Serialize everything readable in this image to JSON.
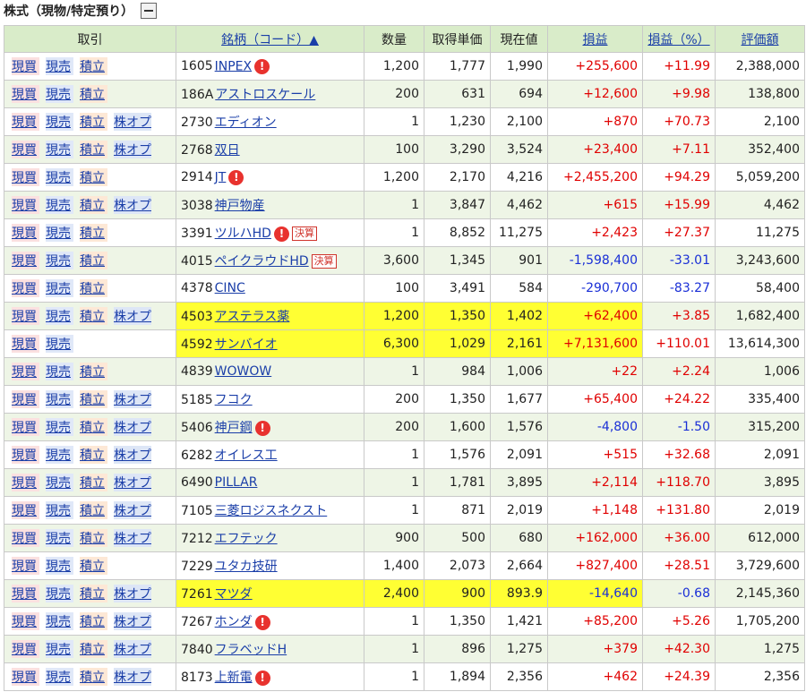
{
  "section": {
    "title": "株式（現物/特定預り）"
  },
  "headers": {
    "trade": "取引",
    "name": "銘柄（コード）▲",
    "qty": "数量",
    "cost": "取得単価",
    "price": "現在値",
    "pl": "損益",
    "plpct": "損益（%）",
    "value": "評価額"
  },
  "actions": {
    "buy": "現買",
    "sell": "現売",
    "accum": "積立",
    "opt": "株オプ"
  },
  "badges": {
    "alert": "!",
    "kessan": "決算"
  },
  "colors": {
    "header_bg": "#d9ecc9",
    "alt_row_bg": "#eef5e6",
    "highlight": "#ffff33",
    "profit": "#e00000",
    "loss": "#1a2fd6"
  },
  "rows": [
    {
      "code": "1605",
      "name": "INPEX",
      "qty": "1,200",
      "cost": "1,777",
      "price": "1,990",
      "pl": "+255,600",
      "plpct": "+11.99",
      "value": "2,388,000"
    },
    {
      "code": "186A",
      "name": "アストロスケール",
      "qty": "200",
      "cost": "631",
      "price": "694",
      "pl": "+12,600",
      "plpct": "+9.98",
      "value": "138,800"
    },
    {
      "code": "2730",
      "name": "エディオン",
      "qty": "1",
      "cost": "1,230",
      "price": "2,100",
      "pl": "+870",
      "plpct": "+70.73",
      "value": "2,100"
    },
    {
      "code": "2768",
      "name": "双日",
      "qty": "100",
      "cost": "3,290",
      "price": "3,524",
      "pl": "+23,400",
      "plpct": "+7.11",
      "value": "352,400"
    },
    {
      "code": "2914",
      "name": "JT",
      "qty": "1,200",
      "cost": "2,170",
      "price": "4,216",
      "pl": "+2,455,200",
      "plpct": "+94.29",
      "value": "5,059,200"
    },
    {
      "code": "3038",
      "name": "神戸物産",
      "qty": "1",
      "cost": "3,847",
      "price": "4,462",
      "pl": "+615",
      "plpct": "+15.99",
      "value": "4,462"
    },
    {
      "code": "3391",
      "name": "ツルハHD",
      "qty": "1",
      "cost": "8,852",
      "price": "11,275",
      "pl": "+2,423",
      "plpct": "+27.37",
      "value": "11,275"
    },
    {
      "code": "4015",
      "name": "ペイクラウドHD",
      "qty": "3,600",
      "cost": "1,345",
      "price": "901",
      "pl": "-1,598,400",
      "plpct": "-33.01",
      "value": "3,243,600"
    },
    {
      "code": "4378",
      "name": "CINC",
      "qty": "100",
      "cost": "3,491",
      "price": "584",
      "pl": "-290,700",
      "plpct": "-83.27",
      "value": "58,400"
    },
    {
      "code": "4503",
      "name": "アステラス薬",
      "qty": "1,200",
      "cost": "1,350",
      "price": "1,402",
      "pl": "+62,400",
      "plpct": "+3.85",
      "value": "1,682,400"
    },
    {
      "code": "4592",
      "name": "サンバイオ",
      "qty": "6,300",
      "cost": "1,029",
      "price": "2,161",
      "pl": "+7,131,600",
      "plpct": "+110.01",
      "value": "13,614,300"
    },
    {
      "code": "4839",
      "name": "WOWOW",
      "qty": "1",
      "cost": "984",
      "price": "1,006",
      "pl": "+22",
      "plpct": "+2.24",
      "value": "1,006"
    },
    {
      "code": "5185",
      "name": "フコク",
      "qty": "200",
      "cost": "1,350",
      "price": "1,677",
      "pl": "+65,400",
      "plpct": "+24.22",
      "value": "335,400"
    },
    {
      "code": "5406",
      "name": "神戸鋼",
      "qty": "200",
      "cost": "1,600",
      "price": "1,576",
      "pl": "-4,800",
      "plpct": "-1.50",
      "value": "315,200"
    },
    {
      "code": "6282",
      "name": "オイレス工",
      "qty": "1",
      "cost": "1,576",
      "price": "2,091",
      "pl": "+515",
      "plpct": "+32.68",
      "value": "2,091"
    },
    {
      "code": "6490",
      "name": "PILLAR",
      "qty": "1",
      "cost": "1,781",
      "price": "3,895",
      "pl": "+2,114",
      "plpct": "+118.70",
      "value": "3,895"
    },
    {
      "code": "7105",
      "name": "三菱ロジスネクスト",
      "qty": "1",
      "cost": "871",
      "price": "2,019",
      "pl": "+1,148",
      "plpct": "+131.80",
      "value": "2,019"
    },
    {
      "code": "7212",
      "name": "エフテック",
      "qty": "900",
      "cost": "500",
      "price": "680",
      "pl": "+162,000",
      "plpct": "+36.00",
      "value": "612,000"
    },
    {
      "code": "7229",
      "name": "ユタカ技研",
      "qty": "1,400",
      "cost": "2,073",
      "price": "2,664",
      "pl": "+827,400",
      "plpct": "+28.51",
      "value": "3,729,600"
    },
    {
      "code": "7261",
      "name": "マツダ",
      "qty": "2,400",
      "cost": "900",
      "price": "893.9",
      "pl": "-14,640",
      "plpct": "-0.68",
      "value": "2,145,360"
    },
    {
      "code": "7267",
      "name": "ホンダ",
      "qty": "1",
      "cost": "1,350",
      "price": "1,421",
      "pl": "+85,200",
      "plpct": "+5.26",
      "value": "1,705,200"
    },
    {
      "code": "7840",
      "name": "フラベッドH",
      "qty": "1",
      "cost": "896",
      "price": "1,275",
      "pl": "+379",
      "plpct": "+42.30",
      "value": "1,275"
    },
    {
      "code": "8173",
      "name": "上新電",
      "qty": "1",
      "cost": "1,894",
      "price": "2,356",
      "pl": "+462",
      "plpct": "+24.39",
      "value": "2,356"
    }
  ]
}
